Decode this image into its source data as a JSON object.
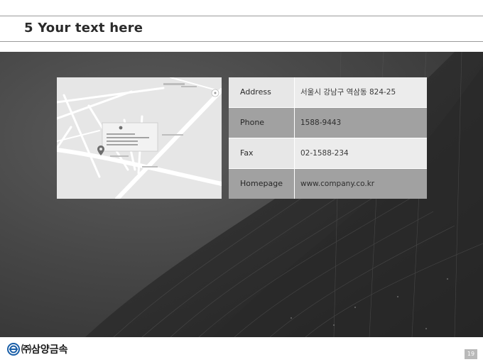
{
  "slide": {
    "title": "5 Your text here",
    "page_number": "19"
  },
  "contact_table": [
    {
      "label": "Address",
      "value": "서울시 강남구 역삼동 824-25"
    },
    {
      "label": "Phone",
      "value": "1588-9443"
    },
    {
      "label": "Fax",
      "value": "02-1588-234"
    },
    {
      "label": "Homepage",
      "value": "www.company.co.kr"
    }
  ],
  "footer": {
    "logo_mark": "㈜",
    "logo_text": "삼양금속"
  },
  "colors": {
    "table_light": "#e7e7e7",
    "table_dark": "#a1a1a1",
    "hero_bg": "#474747",
    "map_bg": "#e9e9e9"
  },
  "icons": {
    "map_marker": "map-pin-icon",
    "logo": "company-logo-icon"
  }
}
